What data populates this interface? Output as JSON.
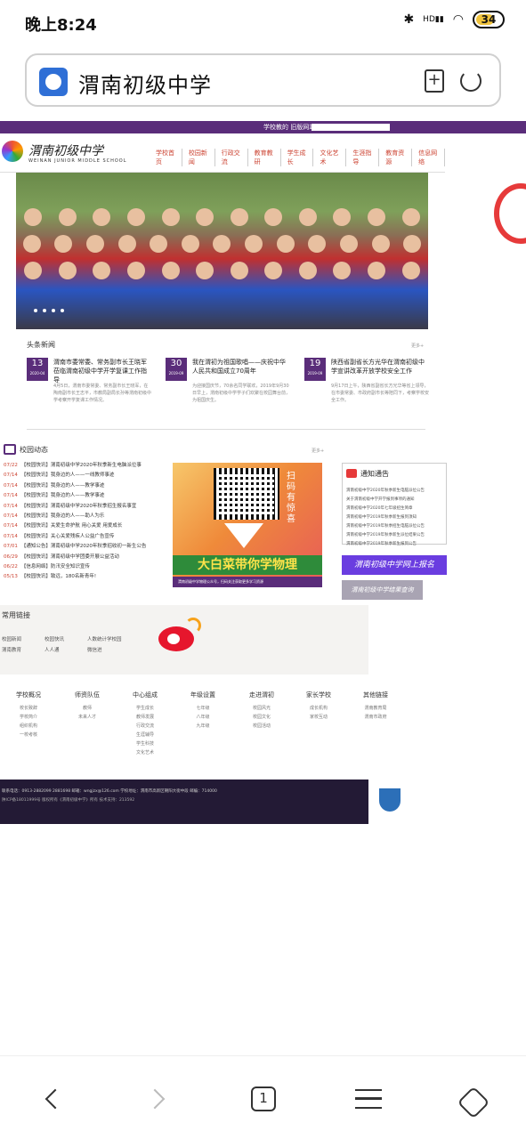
{
  "status_bar": {
    "time": "晚上8:24",
    "network": "HD",
    "battery": "34"
  },
  "browser": {
    "title": "渭南初级中学",
    "tab_count": "1"
  },
  "site": {
    "top_links": "学校教的 旧版网站",
    "logo_text": "渭南初级中学",
    "logo_sub": "WEINAN JUNIOR MIDDLE SCHOOL",
    "nav": [
      "学校首页",
      "校园新闻",
      "行政交流",
      "教育教研",
      "学生成长",
      "文化艺术",
      "生涯指导",
      "教育资源",
      "信息网络"
    ]
  },
  "headlines": {
    "title": "头条新闻",
    "more": "更多+",
    "items": [
      {
        "day": "13",
        "month": "2020-04",
        "title": "渭南市委常委、常务副市长王晓军莅临渭南初级中学开学复课工作指导",
        "body": "4月5日，渭南市委常委、常务副市长王晓军，在陶南副市长王志平，市教局副局长孙等渭南初级中学考察开学复课工作情况。"
      },
      {
        "day": "30",
        "month": "2019-09",
        "title": "我在渭初为祖国歌唱——庆祝中华人民共和国成立70周年",
        "body": "为迎接国庆节，70余名同学联欢，2019年9月30日早上，渭南初级中学学子们欢聚在校园舞台前，为祖国庆生。"
      },
      {
        "day": "19",
        "month": "2019-09",
        "title": "陕西省副省长方光华在渭南初级中学宣讲改革开放学校安全工作",
        "body": "9月17日上午，陕西省副省长方光华等省上领导，在市委常委、市政府副市长等陪同下，考察学校安全工作。"
      }
    ]
  },
  "campus": {
    "title": "校园动态",
    "more": "更多+",
    "items": [
      {
        "date": "07/22",
        "text": "【校园快讯】渭南初级中学2020年秋季新生电脑派位事"
      },
      {
        "date": "07/14",
        "text": "【校园快讯】我身边的人——一线教师事迹"
      },
      {
        "date": "07/14",
        "text": "【校园快讯】我身边的人——教学事迹"
      },
      {
        "date": "07/14",
        "text": "【校园快讯】我身边的人——教学事迹"
      },
      {
        "date": "07/14",
        "text": "【校园快讯】渭南初级中学2020年秋季招生报名事宜"
      },
      {
        "date": "07/14",
        "text": "【校园快讯】我身边的人——助人为乐"
      },
      {
        "date": "07/14",
        "text": "【校园快讯】关爱生命护航 用心关爱 用爱成长"
      },
      {
        "date": "07/14",
        "text": "【校园快讯】关心关爱残疾人公益广告宣传"
      },
      {
        "date": "07/01",
        "text": "【通知公告】渭南初级中学2020年秋季招收初一新生公告"
      },
      {
        "date": "06/29",
        "text": "【校园快讯】渭南初级中学团委开展公益活动"
      },
      {
        "date": "06/22",
        "text": "【信息网络】防汛安全知识宣传"
      },
      {
        "date": "05/13",
        "text": "【校园快讯】致远，180名新青年!"
      }
    ]
  },
  "promo": {
    "scan": "扫码有惊喜",
    "slogan": "大白菜带你学物理",
    "caption": "渭南初级中学物理公众号，扫码关注获取更多学习资源"
  },
  "notice": {
    "title": "通知通告",
    "items": [
      "渭南初级中学2020年秋季新生电脑派位公告",
      "关于渭南初级中学开学报到事项的通知",
      "渭南初级中学2020年七年级招生简章",
      "渭南初级中学2019年秋季新生报到须知",
      "渭南初级中学2019年秋季招生电脑派位公告",
      "渭南初级中学2019年秋季新生派位结果公告",
      "渭南初级中学2019年秋季新生报到公告"
    ]
  },
  "buttons": {
    "enroll": "渭南初级中学网上报名",
    "query": "渭南初级中学结果查询"
  },
  "links": {
    "title": "常用链接",
    "items": [
      "校园新闻",
      "校园快讯",
      "人数统计学校园",
      "渭南教育",
      "人人通",
      "微信进"
    ]
  },
  "footer_nav": [
    {
      "title": "学校概况",
      "items": [
        "校长致辞",
        "学校简介",
        "组织机构",
        "一校考核"
      ]
    },
    {
      "title": "师资队伍",
      "items": [
        "教师",
        "未来人才"
      ]
    },
    {
      "title": "中心组成",
      "items": [
        "学生成长",
        "教师发展",
        "行政交流",
        "生涯辅导",
        "学生科技",
        "文化艺术"
      ]
    },
    {
      "title": "年级设置",
      "items": [
        "七年级",
        "八年级",
        "九年级"
      ]
    },
    {
      "title": "走进渭初",
      "items": [
        "校园风光",
        "校园文化",
        "校园活动"
      ]
    },
    {
      "title": "家长学校",
      "items": [
        "成长机构",
        "家校互动"
      ]
    },
    {
      "title": "其他链接",
      "items": [
        "渭南教育局",
        "渭南市政府"
      ]
    }
  ],
  "footer": {
    "line1": "联系电话：0913-2882099 2881698   邮箱：wngjzx@126.com   学校地址：渭南市高新区朝阳大街中段   邮编：714000",
    "line2": "陕ICP备18011999号 版权所有《渭南初级中学》所有 技术支持：213592"
  }
}
